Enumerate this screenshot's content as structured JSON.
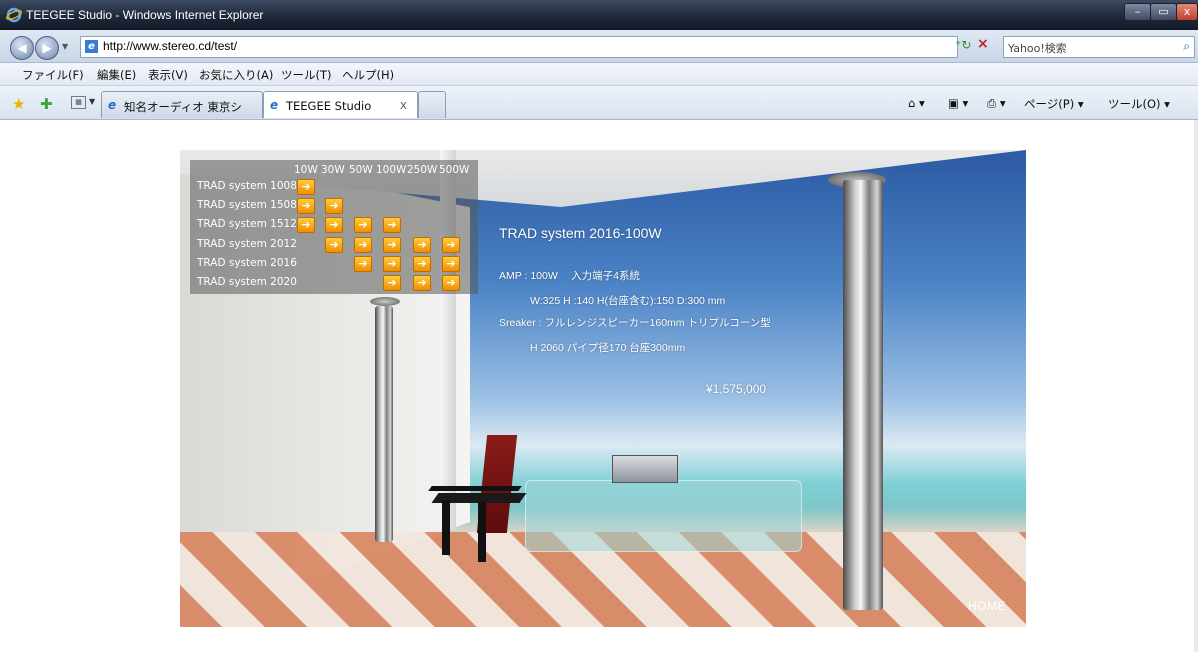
{
  "window": {
    "title": "TEEGEE Studio - Windows Internet Explorer",
    "controls": {
      "min": "–",
      "max": "▭",
      "close": "x"
    }
  },
  "address": {
    "url": "http://www.stereo.cd/test/",
    "search_placeholder": "Yahoo!検索"
  },
  "menu": [
    "ファイル(F)",
    "編集(E)",
    "表示(V)",
    "お気に入り(A)",
    "ツール(T)",
    "ヘルプ(H)"
  ],
  "tabs": [
    {
      "label": "知名オーディオ 東京ショ..."
    },
    {
      "label": "TEEGEE Studio",
      "close": "x"
    }
  ],
  "command_bar": {
    "page": "ページ(P) ▾",
    "tools": "ツール(O) ▾"
  },
  "page": {
    "watts": [
      "10W",
      "30W",
      "50W",
      "100W",
      "250W",
      "500W"
    ],
    "systems": [
      {
        "name": "TRAD system 1008",
        "links": [
          1,
          0,
          0,
          0,
          0,
          0
        ]
      },
      {
        "name": "TRAD system 1508",
        "links": [
          1,
          1,
          0,
          0,
          0,
          0
        ]
      },
      {
        "name": "TRAD system 1512",
        "links": [
          1,
          1,
          1,
          1,
          0,
          0
        ]
      },
      {
        "name": "TRAD system 2012",
        "links": [
          0,
          1,
          1,
          1,
          1,
          1
        ]
      },
      {
        "name": "TRAD system 2016",
        "links": [
          0,
          0,
          1,
          1,
          1,
          1
        ]
      },
      {
        "name": "TRAD system 2020",
        "links": [
          0,
          0,
          0,
          1,
          1,
          1
        ]
      }
    ],
    "arrow_glyph": "➔",
    "spec": {
      "title": "TRAD system 2016-100W",
      "amp": "AMP : 100W　 入力端子4系統",
      "dim": "W:325  H :140  H(台座含む):150  D:300 mm",
      "speaker": "Sreaker : フルレンジスピーカー160mm トリプルコーン型",
      "height": "H 2060  パイプ径170  台座300mm",
      "price": "¥1,575,000"
    },
    "home": "HOME"
  }
}
